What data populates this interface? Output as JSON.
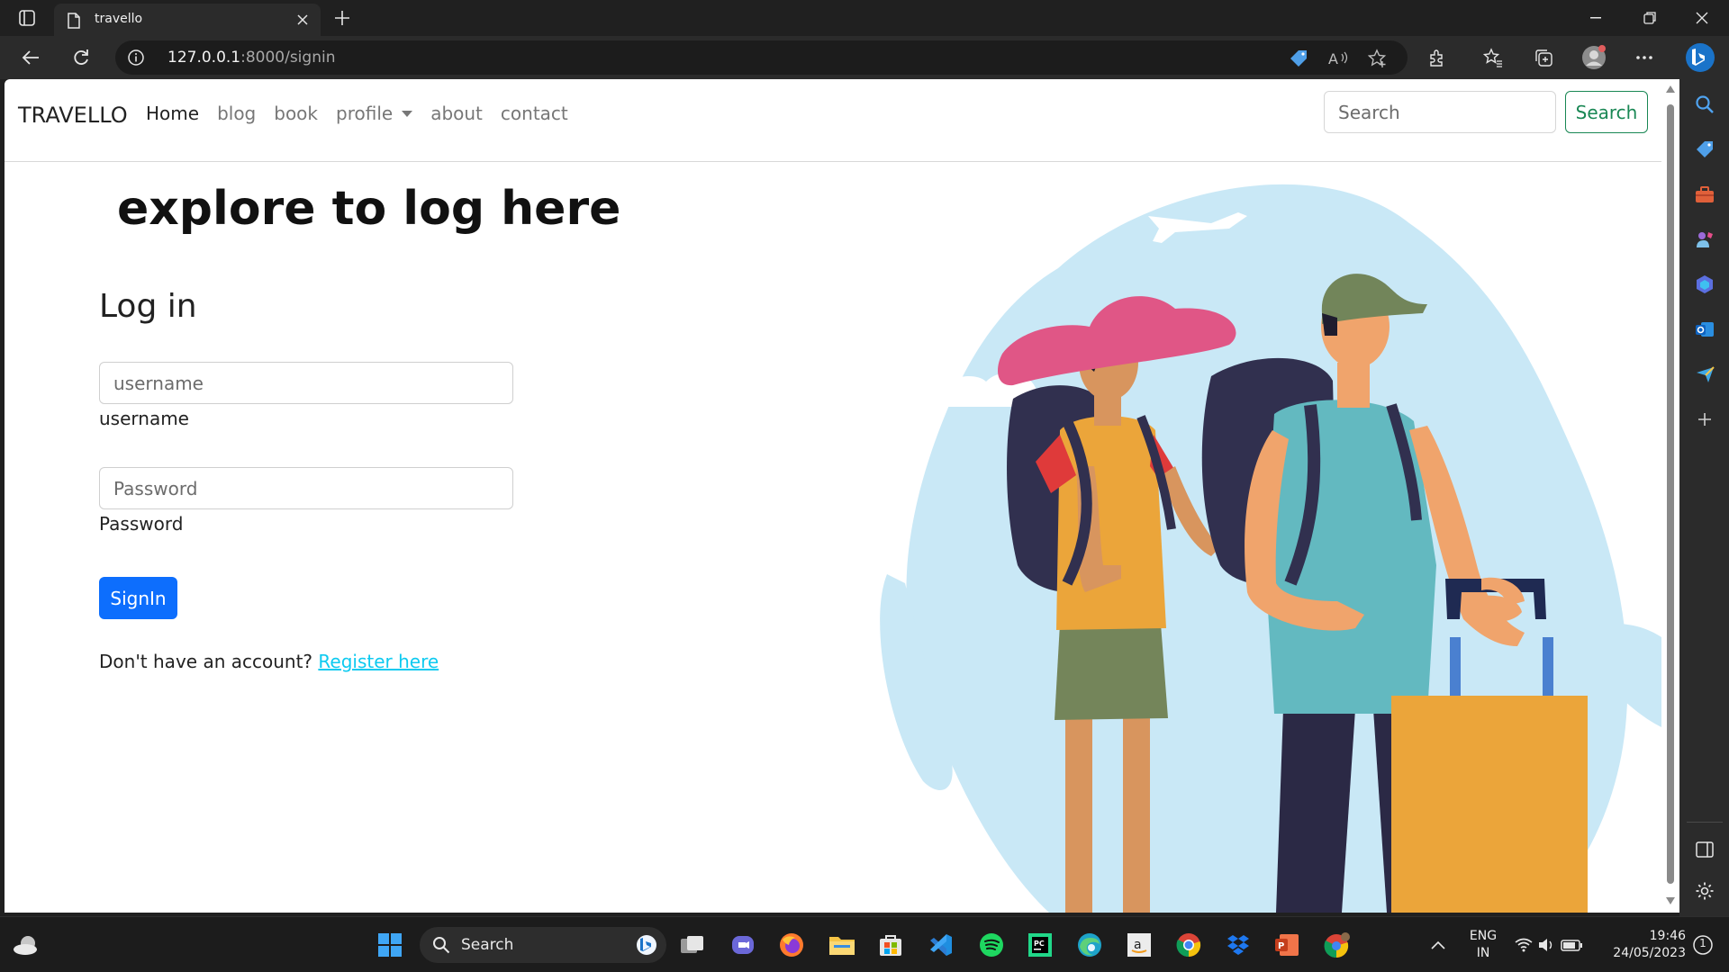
{
  "browser": {
    "tab_title": "travello",
    "url_host": "127.0.0.1",
    "url_rest": ":8000/signin"
  },
  "site": {
    "brand": "TRAVELLO",
    "nav_links": [
      "Home",
      "blog",
      "book",
      "profile",
      "about",
      "contact"
    ],
    "search_placeholder": "Search",
    "search_button": "Search"
  },
  "main": {
    "headline": "explore to log here",
    "login_title": "Log in",
    "username_placeholder": "username",
    "username_label": "username",
    "password_placeholder": "Password",
    "password_label": "Password",
    "signin_button": "SignIn",
    "register_prompt": "Don't have an account?",
    "register_link": "Register here"
  },
  "taskbar": {
    "search_label": "Search",
    "lang_line1": "ENG",
    "lang_line2": "IN",
    "time": "19:46",
    "date": "24/05/2023",
    "notification_count": "1"
  },
  "colors": {
    "primary_button": "#0d6efd",
    "success_outline": "#198754",
    "link": "#0dcaf0",
    "sky_blob": "#c9e8f6"
  }
}
